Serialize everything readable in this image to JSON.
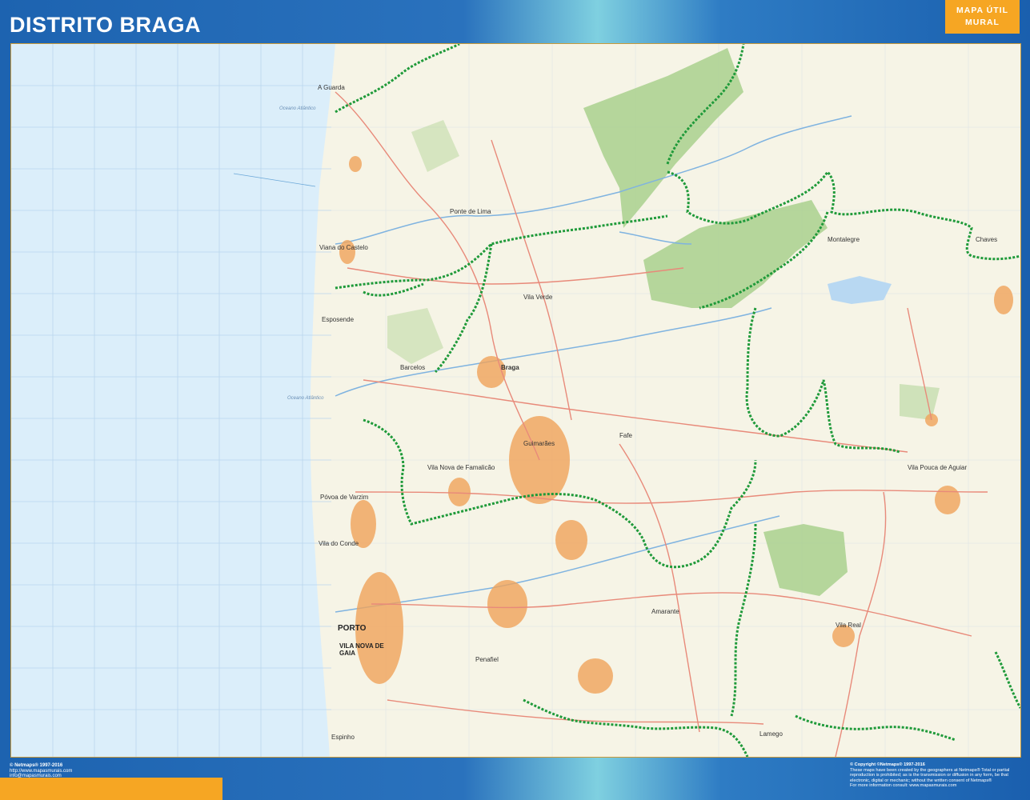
{
  "header": {
    "title": "DISTRITO BRAGA",
    "badge_line1": "MAPA ÚTIL",
    "badge_line2": "MURAL"
  },
  "colors": {
    "frame_blue": "#1f66b2",
    "badge_orange": "#f6a623",
    "sea": "#dbeefa",
    "land": "#f6f4e6",
    "park_green": "#a9d08e",
    "boundary_green": "#1f9a3a",
    "road_red": "#e88a7a",
    "urban_orange": "#f0a35a"
  },
  "map": {
    "sea_labels": [
      "Oceano Atlântico",
      "Oceano Atlântico"
    ],
    "places": {
      "caminha": "A Guarda",
      "viana": "Viana do Castelo",
      "esposende": "Esposende",
      "povoa": "Póvoa de Varzim",
      "viladoconde": "Vila do Conde",
      "porto": "PORTO",
      "gaia": "VILA NOVA DE GAIA",
      "braga": "Braga",
      "barcelos": "Barcelos",
      "guimaraes": "Guimarães",
      "famalicao": "Vila Nova de Famalicão",
      "fafe": "Fafe",
      "ponte_lima": "Ponte de Lima",
      "vila_verde": "Vila Verde",
      "amarante": "Amarante",
      "vila_pouca": "Vila Pouca de Aguiar",
      "montalegre": "Montalegre",
      "vila_real": "Vila Real",
      "chaves": "Chaves",
      "penafiel": "Penafiel",
      "lamego": "Lamego",
      "espinho": "Espinho"
    }
  },
  "footer": {
    "left_line1": "© Netmaps® 1997-2016",
    "left_line2": "http://www.mapasmurais.com",
    "left_line3": "info@mapasmurais.com",
    "right_line1": "© Copyright ©Netmaps® 1997-2016",
    "right_line2": "These maps have been created by the geographers at Netmaps® Total or partial",
    "right_line3": "reproduction is prohibited; as is the transmission or diffusion in any form, be that",
    "right_line4": "electronic, digital or mechanic; without the written consent of Netmaps®",
    "right_line5": "For more information consult: www.mapasmurais.com"
  }
}
